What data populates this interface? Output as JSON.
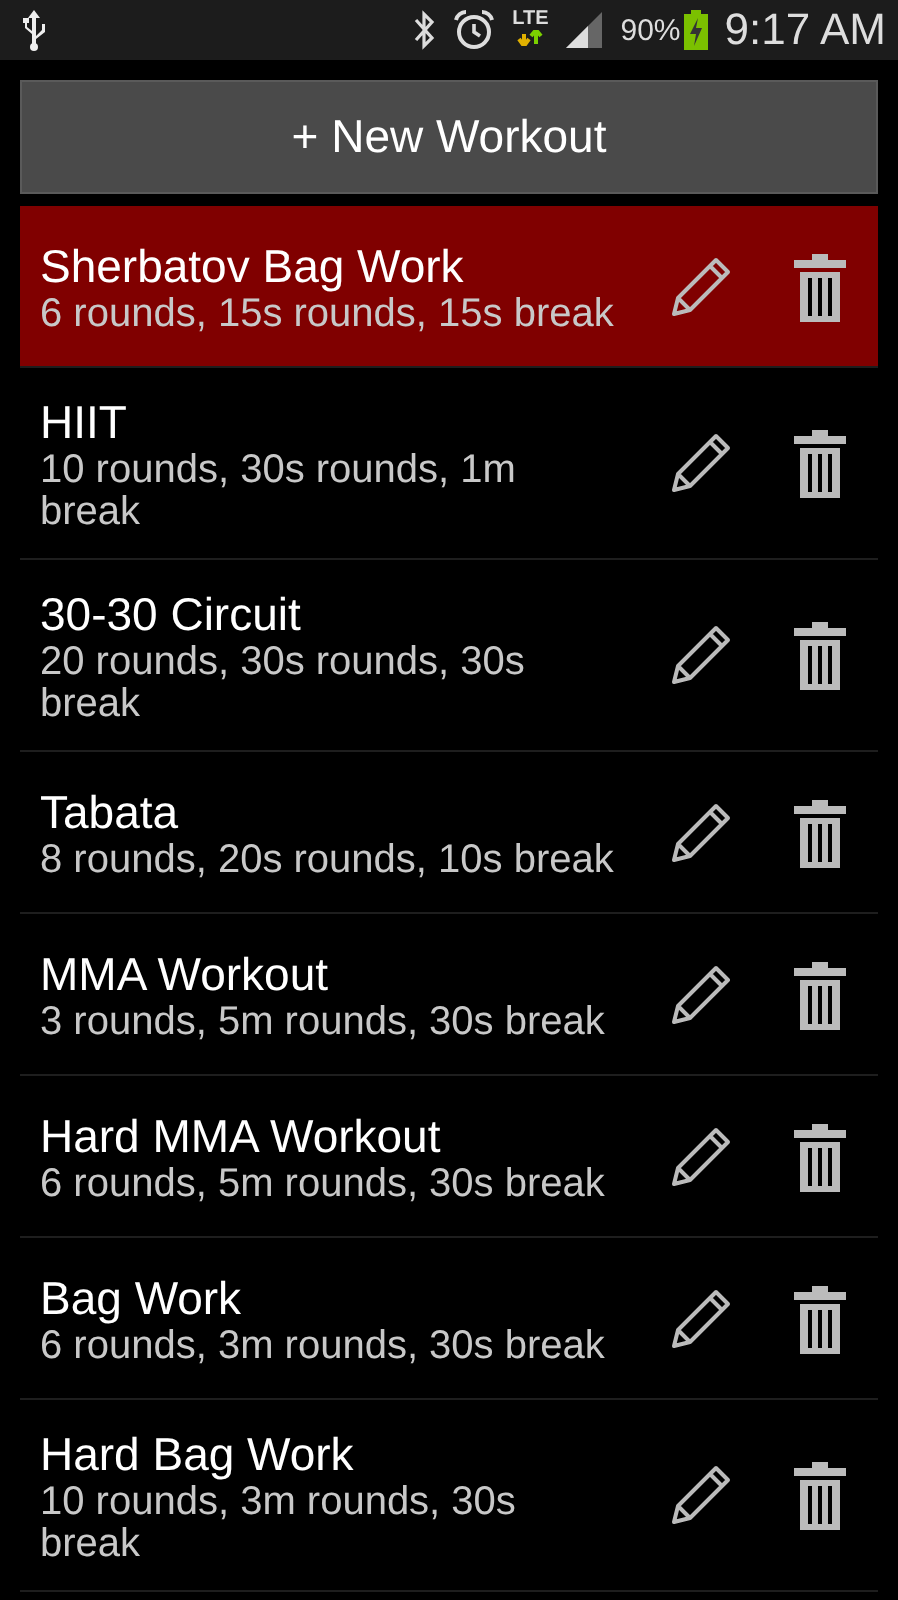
{
  "status_bar": {
    "battery": "90%",
    "time": "9:17 AM",
    "network": "LTE"
  },
  "new_button": {
    "label": "+ New Workout"
  },
  "workouts": [
    {
      "name": "Sherbatov Bag Work",
      "summary": "6 rounds, 15s rounds, 15s break",
      "selected": true
    },
    {
      "name": "HIIT",
      "summary": "10 rounds, 30s rounds, 1m break",
      "selected": false
    },
    {
      "name": "30-30 Circuit",
      "summary": "20 rounds, 30s rounds, 30s break",
      "selected": false
    },
    {
      "name": "Tabata",
      "summary": "8 rounds, 20s rounds, 10s break",
      "selected": false
    },
    {
      "name": "MMA Workout",
      "summary": "3 rounds, 5m rounds, 30s break",
      "selected": false
    },
    {
      "name": "Hard MMA Workout",
      "summary": "6 rounds, 5m rounds, 30s break",
      "selected": false
    },
    {
      "name": "Bag Work",
      "summary": "6 rounds, 3m rounds, 30s break",
      "selected": false
    },
    {
      "name": "Hard Bag Work",
      "summary": "10 rounds, 3m rounds, 30s break",
      "selected": false
    }
  ]
}
